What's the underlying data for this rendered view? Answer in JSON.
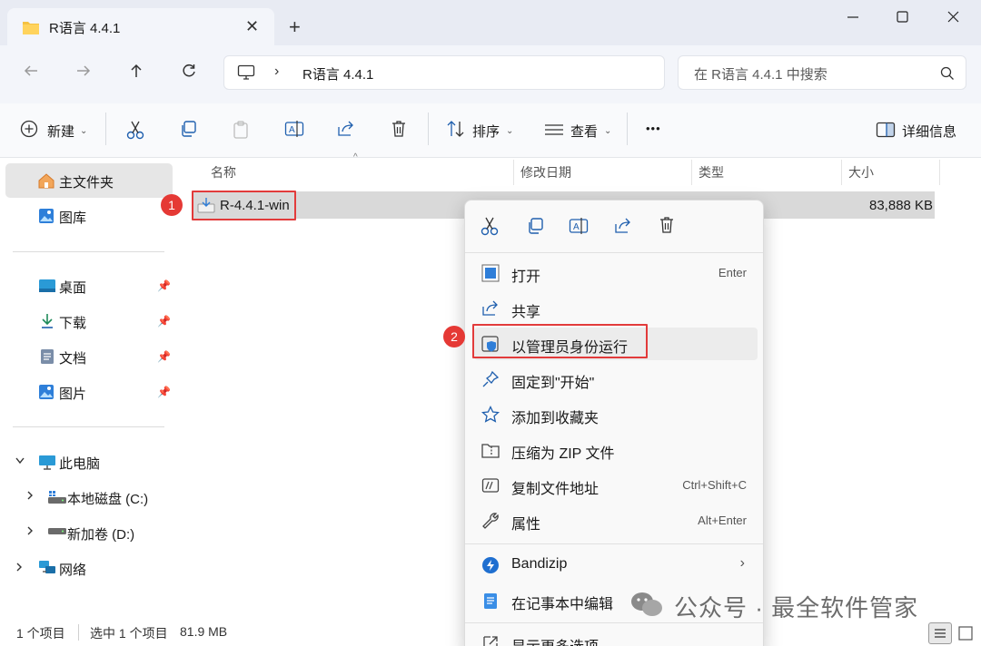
{
  "window": {
    "tab_title": "R语言 4.4.1",
    "close_tab": "✕",
    "new_tab": "+"
  },
  "address": {
    "path_separator": "›",
    "path": "R语言 4.4.1",
    "search_placeholder": "在 R语言 4.4.1 中搜索"
  },
  "toolbar": {
    "new_label": "新建",
    "sort_label": "排序",
    "view_label": "查看",
    "more_label": "•••",
    "details_label": "详细信息"
  },
  "sidebar": {
    "home": "主文件夹",
    "gallery": "图库",
    "desktop": "桌面",
    "downloads": "下载",
    "documents": "文档",
    "pictures": "图片",
    "this_pc": "此电脑",
    "drive_c": "本地磁盘 (C:)",
    "drive_d": "新加卷 (D:)",
    "network": "网络"
  },
  "columns": {
    "name": "名称",
    "modified": "修改日期",
    "type": "类型",
    "size": "大小"
  },
  "files": [
    {
      "name": "R-4.4.1-win",
      "size": "83,888 KB"
    }
  ],
  "annotations": {
    "step1": "1",
    "step2": "2"
  },
  "status": {
    "count": "1 个项目",
    "selected": "选中 1 个项目",
    "size": "81.9 MB"
  },
  "context_menu": {
    "items": [
      {
        "label": "打开",
        "shortcut": "Enter"
      },
      {
        "label": "共享",
        "shortcut": ""
      },
      {
        "label": "以管理员身份运行",
        "shortcut": ""
      },
      {
        "label": "固定到\"开始\"",
        "shortcut": ""
      },
      {
        "label": "添加到收藏夹",
        "shortcut": ""
      },
      {
        "label": "压缩为 ZIP 文件",
        "shortcut": ""
      },
      {
        "label": "复制文件地址",
        "shortcut": "Ctrl+Shift+C"
      },
      {
        "label": "属性",
        "shortcut": "Alt+Enter"
      },
      {
        "label": "Bandizip",
        "shortcut": ""
      },
      {
        "label": "在记事本中编辑",
        "shortcut": ""
      },
      {
        "label": "显示更多选项",
        "shortcut": ""
      }
    ]
  },
  "watermark": "公众号 · 最全软件管家",
  "colors": {
    "accent": "#0067c0",
    "annotation": "#e23b3b"
  }
}
